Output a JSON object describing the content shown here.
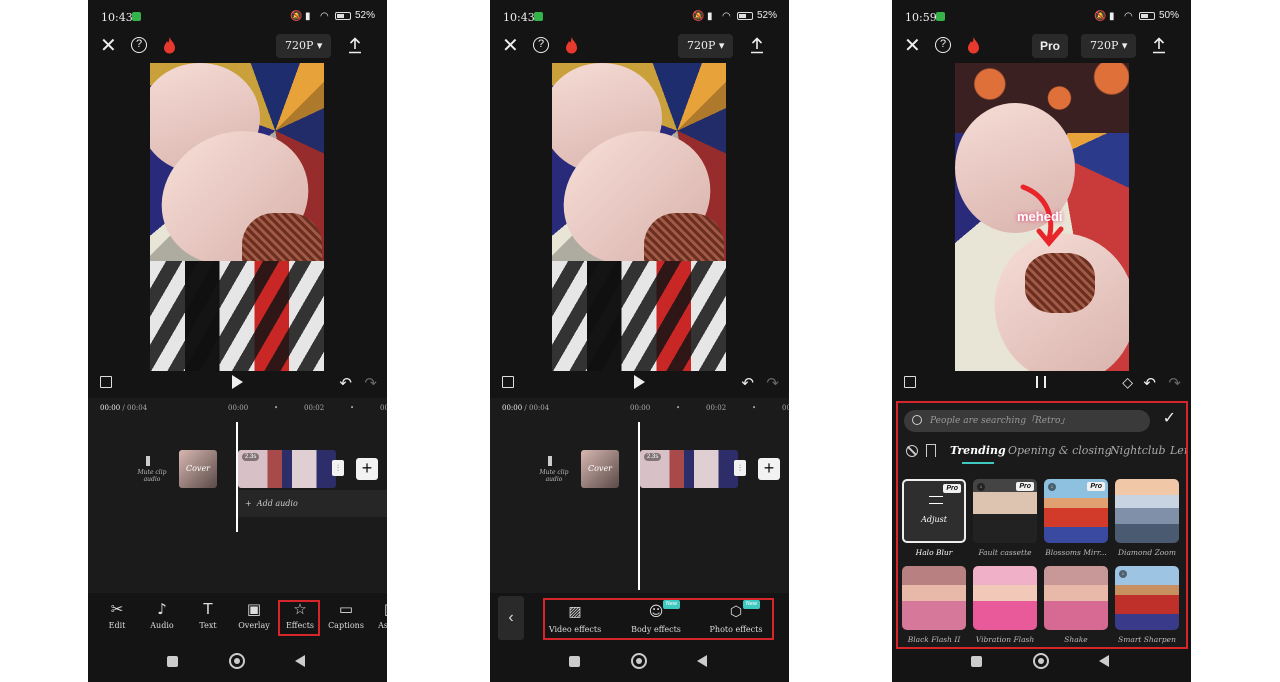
{
  "colors": {
    "highlight": "#d7262b",
    "accent": "#3fc8c0"
  },
  "screens": [
    {
      "status": {
        "time": "10:43",
        "battery": "52%"
      },
      "resolution": "720P",
      "timeline": {
        "current": "00:00",
        "total": "/ 00:04",
        "ruler": [
          "00:00",
          "00:02",
          "00"
        ]
      },
      "mute_label": "Mute clip audio",
      "cover_label": "Cover",
      "clip_duration": "2.3s",
      "add_audio": "Add audio",
      "tools": [
        "Edit",
        "Audio",
        "Text",
        "Overlay",
        "Effects",
        "Captions",
        "Aspe"
      ]
    },
    {
      "status": {
        "time": "10:43",
        "battery": "52%"
      },
      "resolution": "720P",
      "timeline": {
        "current": "00:00",
        "total": "/ 00:04",
        "ruler": [
          "00:00",
          "00:02",
          "00"
        ]
      },
      "mute_label": "Mute clip audio",
      "cover_label": "Cover",
      "clip_duration": "2.3s",
      "effect_types": [
        {
          "label": "Video effects",
          "badge": ""
        },
        {
          "label": "Body effects",
          "badge": "New"
        },
        {
          "label": "Photo effects",
          "badge": "New"
        }
      ]
    },
    {
      "status": {
        "time": "10:59",
        "battery": "50%"
      },
      "resolution": "720P",
      "pro_label": "Pro",
      "preview_text": "mehedi",
      "search_placeholder": "People are searching「Retro」",
      "categories": [
        "Trending",
        "Opening & closing",
        "Nightclub",
        "Lens"
      ],
      "adjust_label": "Adjust",
      "pro_badge": "Pro",
      "effects": [
        "Halo Blur",
        "Fault cassette",
        "Blossoms Mirr...",
        "Diamond Zoom",
        "Black Flash II",
        "Vibration Flash",
        "Shake",
        "Smart Sharpen"
      ]
    }
  ]
}
